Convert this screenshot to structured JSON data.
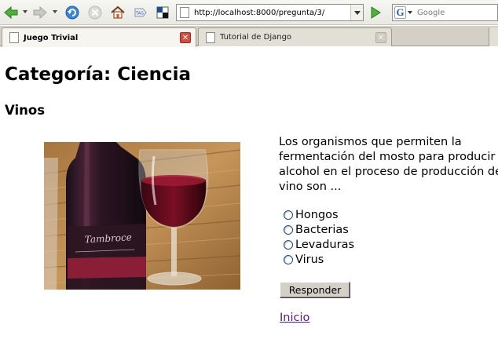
{
  "browser": {
    "address": {
      "url": "http://localhost:8000/pregunta/3/"
    },
    "search": {
      "placeholder": "Google"
    },
    "tabs": [
      {
        "label": "Juego Trivial",
        "active": true
      },
      {
        "label": "Tutorial de Django",
        "active": false
      }
    ],
    "icons": {
      "back": "back-arrow-icon",
      "forward": "forward-arrow-icon",
      "reload": "reload-icon",
      "stop": "stop-icon",
      "home": "home-icon",
      "tag": "tag-icon",
      "bookmark": "bookmark-icon",
      "go": "go-arrow-icon",
      "search_engine": "google-icon"
    },
    "colors": {
      "nav_green": "#3f9a2f",
      "reload_blue": "#2a77d4",
      "close_red": "#d24c3f",
      "visited_link": "#551a8b"
    }
  },
  "page": {
    "category_heading": "Categoría: Ciencia",
    "question_title": "Vinos",
    "question_text": "Los organismos que permiten la fermentación del mosto para producir alcohol en el proceso de producción de vino son ...",
    "options": [
      "Hongos",
      "Bacterias",
      "Levaduras",
      "Virus"
    ],
    "submit_label": "Responder",
    "home_link": "Inicio",
    "bottle_label_text": "Tambroce"
  }
}
